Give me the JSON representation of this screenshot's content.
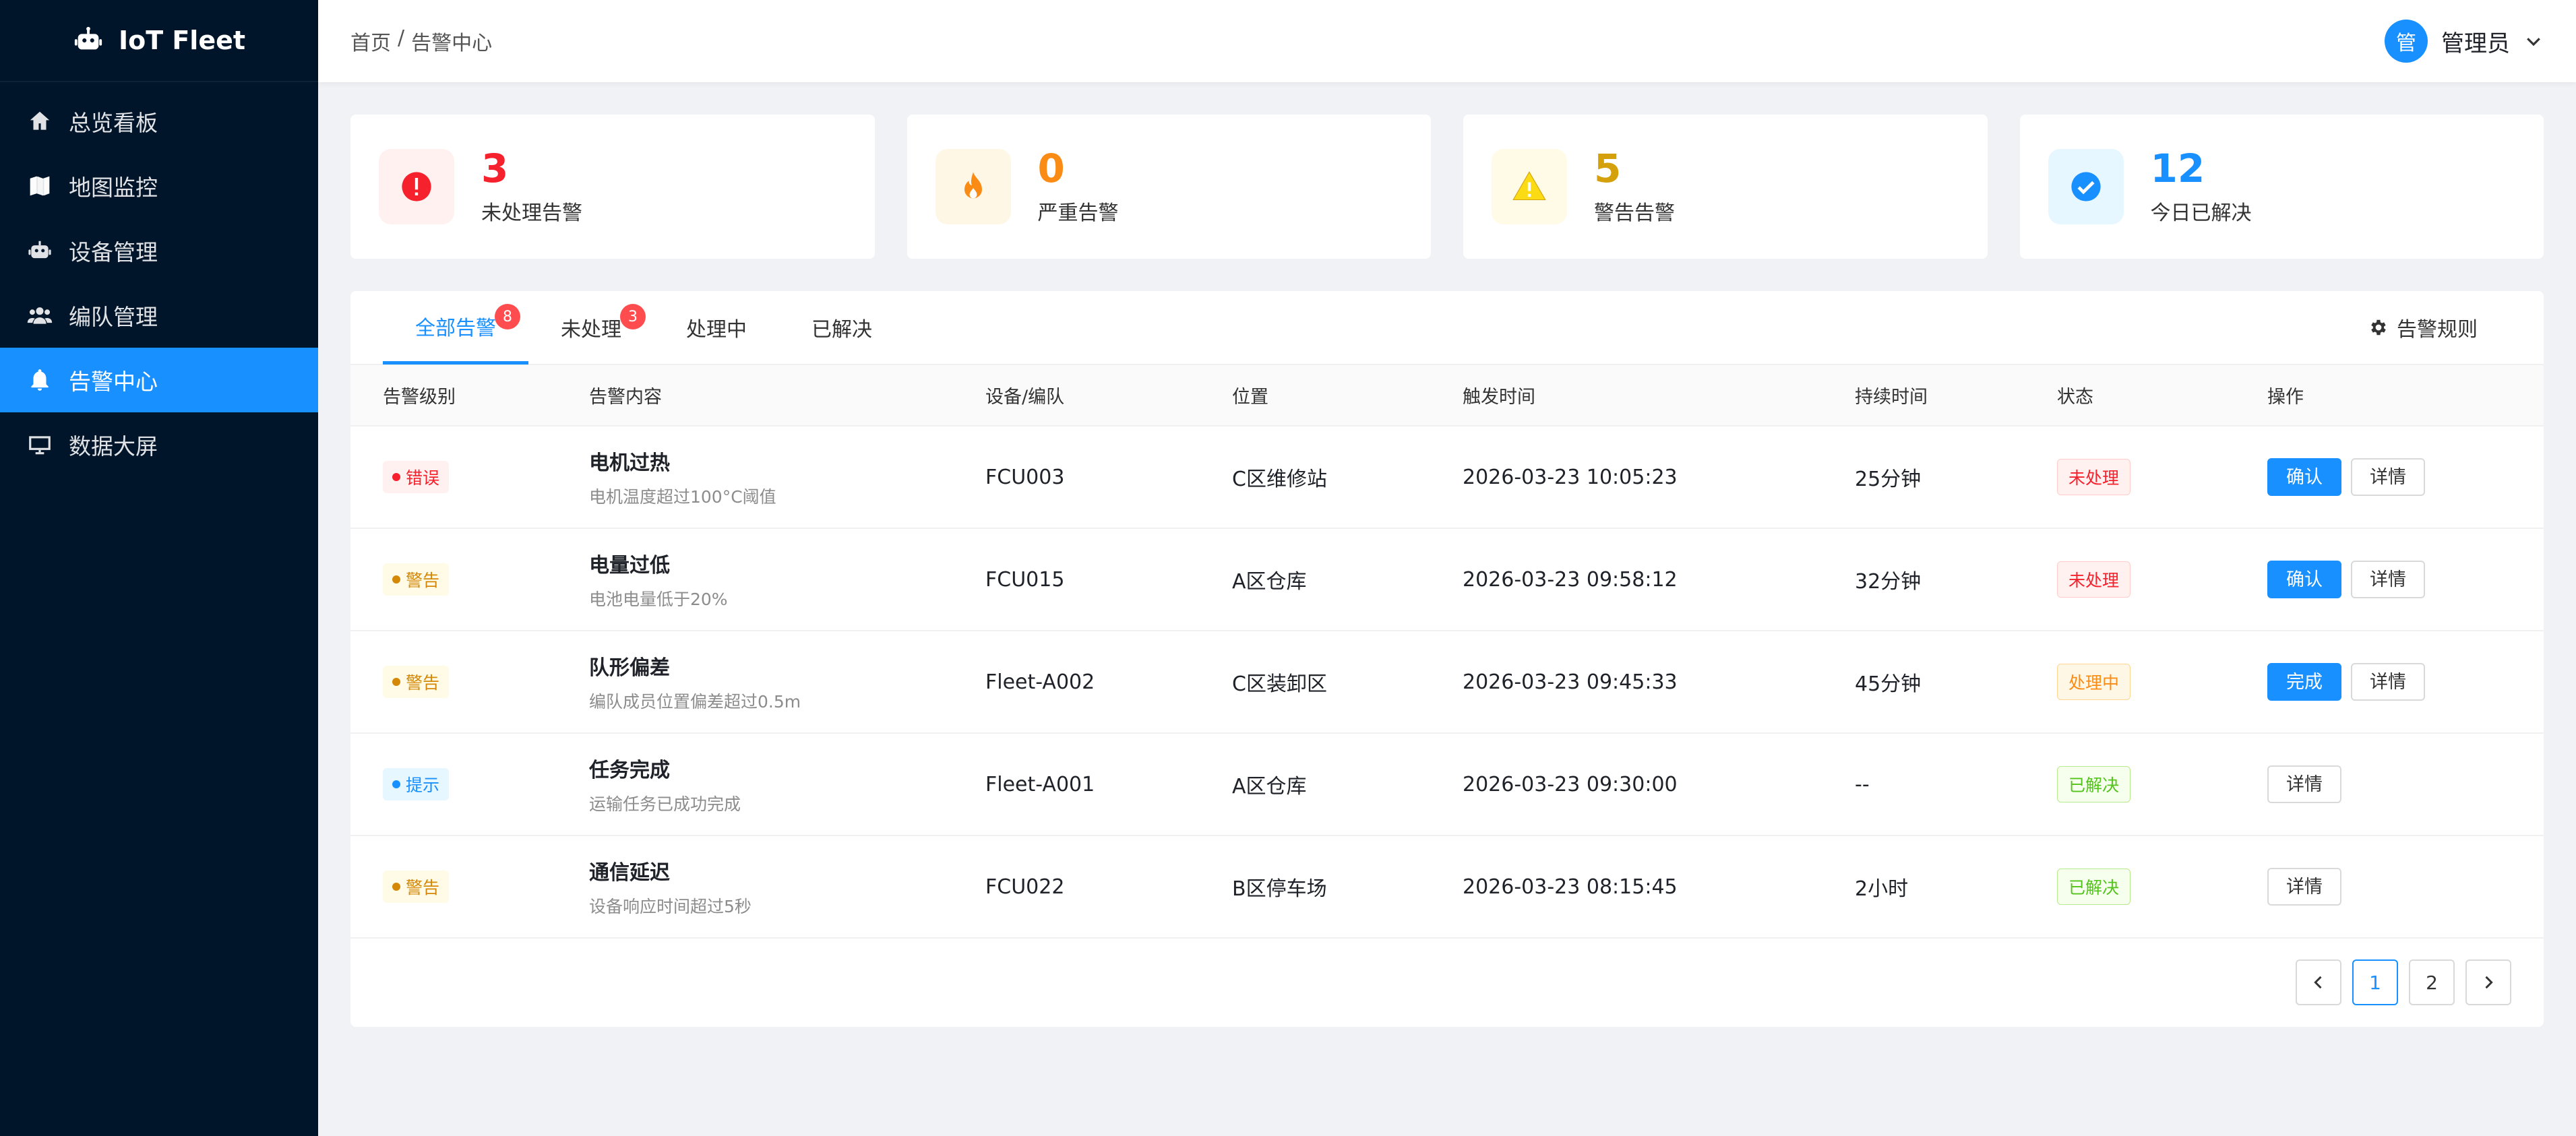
{
  "app": {
    "title": "IoT Fleet"
  },
  "sidebar": {
    "items": [
      {
        "label": "总览看板",
        "icon": "home-icon",
        "active": false
      },
      {
        "label": "地图监控",
        "icon": "map-icon",
        "active": false
      },
      {
        "label": "设备管理",
        "icon": "robot-icon",
        "active": false
      },
      {
        "label": "编队管理",
        "icon": "users-icon",
        "active": false
      },
      {
        "label": "告警中心",
        "icon": "bell-icon",
        "active": true
      },
      {
        "label": "数据大屏",
        "icon": "monitor-icon",
        "active": false
      }
    ]
  },
  "header": {
    "breadcrumb": [
      "首页",
      "/",
      "告警中心"
    ],
    "user": {
      "avatar_text": "管",
      "name": "管理员"
    }
  },
  "stats": [
    {
      "value": "3",
      "label": "未处理告警",
      "color": "#f5222d",
      "bg": "#fff1f0",
      "icon": "exclamation-circle-icon"
    },
    {
      "value": "0",
      "label": "严重告警",
      "color": "#fa8c16",
      "bg": "#fff7e6",
      "icon": "fire-icon"
    },
    {
      "value": "5",
      "label": "警告告警",
      "color": "#d4a10c",
      "bg": "#fffbe6",
      "icon": "warning-triangle-icon"
    },
    {
      "value": "12",
      "label": "今日已解决",
      "color": "#1890ff",
      "bg": "#e6f7ff",
      "icon": "check-circle-icon"
    }
  ],
  "tabs": [
    {
      "label": "全部告警",
      "badge": "8",
      "active": true
    },
    {
      "label": "未处理",
      "badge": "3",
      "active": false
    },
    {
      "label": "处理中",
      "badge": "",
      "active": false
    },
    {
      "label": "已解决",
      "badge": "",
      "active": false
    }
  ],
  "rules_label": "告警规则",
  "table": {
    "headers": [
      "告警级别",
      "告警内容",
      "设备/编队",
      "位置",
      "触发时间",
      "持续时间",
      "状态",
      "操作"
    ],
    "rows": [
      {
        "level": "错误",
        "level_color": "#f5222d",
        "level_bg": "#fff1f0",
        "title": "电机过热",
        "desc": "电机温度超过100°C阈值",
        "device": "FCU003",
        "location": "C区维修站",
        "time": "2026-03-23 10:05:23",
        "duration": "25分钟",
        "status": "未处理",
        "status_color": "#f5222d",
        "status_bg": "#fff1f0",
        "status_border": "#ffccc7",
        "primary_action": "确认",
        "detail_action": "详情"
      },
      {
        "level": "警告",
        "level_color": "#d48806",
        "level_bg": "#fffbe6",
        "title": "电量过低",
        "desc": "电池电量低于20%",
        "device": "FCU015",
        "location": "A区仓库",
        "time": "2026-03-23 09:58:12",
        "duration": "32分钟",
        "status": "未处理",
        "status_color": "#f5222d",
        "status_bg": "#fff1f0",
        "status_border": "#ffccc7",
        "primary_action": "确认",
        "detail_action": "详情"
      },
      {
        "level": "警告",
        "level_color": "#d48806",
        "level_bg": "#fffbe6",
        "title": "队形偏差",
        "desc": "编队成员位置偏差超过0.5m",
        "device": "Fleet-A002",
        "location": "C区装卸区",
        "time": "2026-03-23 09:45:33",
        "duration": "45分钟",
        "status": "处理中",
        "status_color": "#fa8c16",
        "status_bg": "#fff7e6",
        "status_border": "#ffd591",
        "primary_action": "完成",
        "detail_action": "详情"
      },
      {
        "level": "提示",
        "level_color": "#1890ff",
        "level_bg": "#e6f7ff",
        "title": "任务完成",
        "desc": "运输任务已成功完成",
        "device": "Fleet-A001",
        "location": "A区仓库",
        "time": "2026-03-23 09:30:00",
        "duration": "--",
        "status": "已解决",
        "status_color": "#52c41a",
        "status_bg": "#f6ffed",
        "status_border": "#b7eb8f",
        "primary_action": "",
        "detail_action": "详情"
      },
      {
        "level": "警告",
        "level_color": "#d48806",
        "level_bg": "#fffbe6",
        "title": "通信延迟",
        "desc": "设备响应时间超过5秒",
        "device": "FCU022",
        "location": "B区停车场",
        "time": "2026-03-23 08:15:45",
        "duration": "2小时",
        "status": "已解决",
        "status_color": "#52c41a",
        "status_bg": "#f6ffed",
        "status_border": "#b7eb8f",
        "primary_action": "",
        "detail_action": "详情"
      }
    ]
  },
  "pagination": {
    "pages": [
      "1",
      "2"
    ],
    "current": "1"
  }
}
